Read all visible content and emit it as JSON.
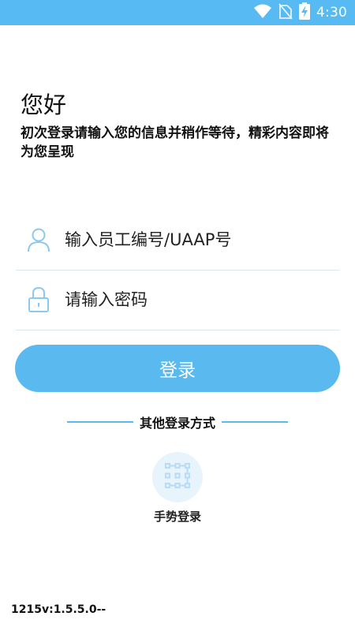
{
  "status_bar": {
    "time": "4:30",
    "icons": [
      "wifi-icon",
      "no-sim-icon",
      "battery-charging-icon"
    ],
    "background_color": "#58baf2"
  },
  "greeting": {
    "title": "您好",
    "subtitle": "初次登录请输入您的信息并稍作等待，精彩内容即将为您呈现"
  },
  "form": {
    "account_placeholder": "输入员工编号/UAAP号",
    "account_icon": "user-icon",
    "password_placeholder": "请输入密码",
    "password_icon": "lock-icon"
  },
  "login_button": {
    "label": "登录",
    "color": "#5ab9ef"
  },
  "other_login": {
    "divider_text": "其他登录方式",
    "gesture_label": "手势登录",
    "gesture_icon": "gesture-grid-icon"
  },
  "version": "1215v:1.5.5.0--"
}
